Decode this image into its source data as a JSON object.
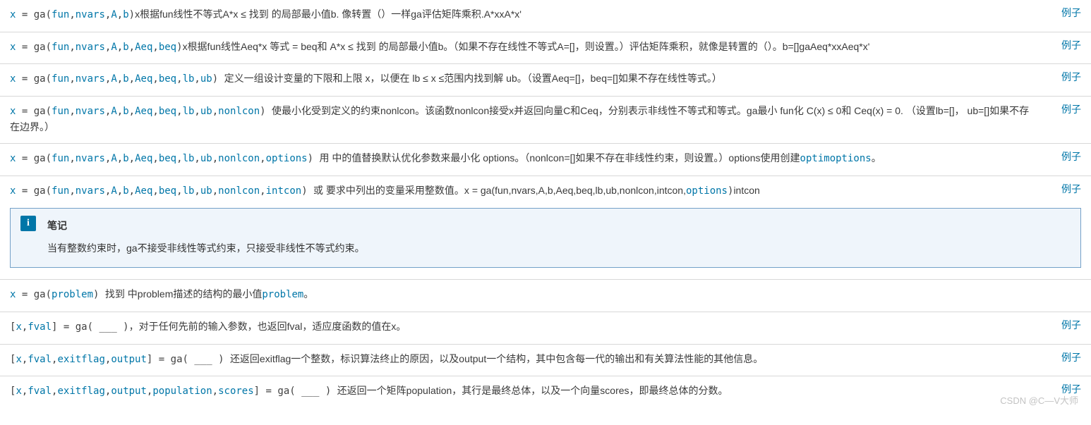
{
  "labels": {
    "example": "例子",
    "note_title": "笔记",
    "note_body": "当有整数约束时，ga不接受非线性等式约束，只接受非线性不等式约束。",
    "watermark": "CSDN @C—V大师"
  },
  "rows": [
    {
      "has_example": true,
      "parts": [
        {
          "t": "k",
          "v": "x"
        },
        {
          "t": "code",
          "v": " = ga("
        },
        {
          "t": "k",
          "v": "fun"
        },
        {
          "t": "code",
          "v": ","
        },
        {
          "t": "k",
          "v": "nvars"
        },
        {
          "t": "code",
          "v": ","
        },
        {
          "t": "k",
          "v": "A"
        },
        {
          "t": "code",
          "v": ","
        },
        {
          "t": "k",
          "v": "b"
        },
        {
          "t": "code",
          "v": ")"
        },
        {
          "t": "txt",
          "v": "x根据fun线性不等式A*x ≤ 找到 的局部最小值b. 像转置（）一样ga评估矩阵乘积.A*xxA*x'"
        }
      ]
    },
    {
      "has_example": true,
      "parts": [
        {
          "t": "k",
          "v": "x"
        },
        {
          "t": "code",
          "v": " = ga("
        },
        {
          "t": "k",
          "v": "fun"
        },
        {
          "t": "code",
          "v": ","
        },
        {
          "t": "k",
          "v": "nvars"
        },
        {
          "t": "code",
          "v": ","
        },
        {
          "t": "k",
          "v": "A"
        },
        {
          "t": "code",
          "v": ","
        },
        {
          "t": "k",
          "v": "b"
        },
        {
          "t": "code",
          "v": ","
        },
        {
          "t": "k",
          "v": "Aeq"
        },
        {
          "t": "code",
          "v": ","
        },
        {
          "t": "k",
          "v": "beq"
        },
        {
          "t": "code",
          "v": ")"
        },
        {
          "t": "txt",
          "v": "x根据fun线性Aeq*x 等式 = beq和 A*x ≤ 找到 的局部最小值b。（如果不存在线性不等式A=[]，则设置。）评估矩阵乘积，就像是转置的（）。b=[]gaAeq*xxAeq*x'"
        }
      ]
    },
    {
      "has_example": true,
      "parts": [
        {
          "t": "k",
          "v": "x"
        },
        {
          "t": "code",
          "v": " = ga("
        },
        {
          "t": "k",
          "v": "fun"
        },
        {
          "t": "code",
          "v": ","
        },
        {
          "t": "k",
          "v": "nvars"
        },
        {
          "t": "code",
          "v": ","
        },
        {
          "t": "k",
          "v": "A"
        },
        {
          "t": "code",
          "v": ","
        },
        {
          "t": "k",
          "v": "b"
        },
        {
          "t": "code",
          "v": ","
        },
        {
          "t": "k",
          "v": "Aeq"
        },
        {
          "t": "code",
          "v": ","
        },
        {
          "t": "k",
          "v": "beq"
        },
        {
          "t": "code",
          "v": ","
        },
        {
          "t": "k",
          "v": "lb"
        },
        {
          "t": "code",
          "v": ","
        },
        {
          "t": "k",
          "v": "ub"
        },
        {
          "t": "code",
          "v": ") "
        },
        {
          "t": "txt",
          "v": "定义一组设计变量的下限和上限 x，以便在 lb ≤  x ≤范围内找到解 ub。（设置Aeq=[]，beq=[]如果不存在线性等式。）"
        }
      ]
    },
    {
      "has_example": true,
      "parts": [
        {
          "t": "k",
          "v": "x"
        },
        {
          "t": "code",
          "v": " = ga("
        },
        {
          "t": "k",
          "v": "fun"
        },
        {
          "t": "code",
          "v": ","
        },
        {
          "t": "k",
          "v": "nvars"
        },
        {
          "t": "code",
          "v": ","
        },
        {
          "t": "k",
          "v": "A"
        },
        {
          "t": "code",
          "v": ","
        },
        {
          "t": "k",
          "v": "b"
        },
        {
          "t": "code",
          "v": ","
        },
        {
          "t": "k",
          "v": "Aeq"
        },
        {
          "t": "code",
          "v": ","
        },
        {
          "t": "k",
          "v": "beq"
        },
        {
          "t": "code",
          "v": ","
        },
        {
          "t": "k",
          "v": "lb"
        },
        {
          "t": "code",
          "v": ","
        },
        {
          "t": "k",
          "v": "ub"
        },
        {
          "t": "code",
          "v": ","
        },
        {
          "t": "k",
          "v": "nonlcon"
        },
        {
          "t": "code",
          "v": ") "
        },
        {
          "t": "txt",
          "v": "使最小化受到定义的约束nonlcon。该函数nonlcon接受x并返回向量C和Ceq，分别表示非线性不等式和等式。ga最小 fun化 C(x) ≤ 0和 Ceq(x) = 0. （设置lb=[]， ub=[]如果不存在边界。）"
        }
      ]
    },
    {
      "has_example": true,
      "parts": [
        {
          "t": "k",
          "v": "x"
        },
        {
          "t": "code",
          "v": " = ga("
        },
        {
          "t": "k",
          "v": "fun"
        },
        {
          "t": "code",
          "v": ","
        },
        {
          "t": "k",
          "v": "nvars"
        },
        {
          "t": "code",
          "v": ","
        },
        {
          "t": "k",
          "v": "A"
        },
        {
          "t": "code",
          "v": ","
        },
        {
          "t": "k",
          "v": "b"
        },
        {
          "t": "code",
          "v": ","
        },
        {
          "t": "k",
          "v": "Aeq"
        },
        {
          "t": "code",
          "v": ","
        },
        {
          "t": "k",
          "v": "beq"
        },
        {
          "t": "code",
          "v": ","
        },
        {
          "t": "k",
          "v": "lb"
        },
        {
          "t": "code",
          "v": ","
        },
        {
          "t": "k",
          "v": "ub"
        },
        {
          "t": "code",
          "v": ","
        },
        {
          "t": "k",
          "v": "nonlcon"
        },
        {
          "t": "code",
          "v": ","
        },
        {
          "t": "k",
          "v": "options"
        },
        {
          "t": "code",
          "v": ") "
        },
        {
          "t": "txt",
          "v": "用 中的值替换默认优化参数来最小化 options。（nonlcon=[]如果不存在非线性约束，则设置。）options使用创建"
        },
        {
          "t": "link",
          "v": "optimoptions"
        },
        {
          "t": "txt",
          "v": "。"
        }
      ]
    },
    {
      "has_example": true,
      "note": true,
      "parts": [
        {
          "t": "k",
          "v": "x"
        },
        {
          "t": "code",
          "v": " = ga("
        },
        {
          "t": "k",
          "v": "fun"
        },
        {
          "t": "code",
          "v": ","
        },
        {
          "t": "k",
          "v": "nvars"
        },
        {
          "t": "code",
          "v": ","
        },
        {
          "t": "k",
          "v": "A"
        },
        {
          "t": "code",
          "v": ","
        },
        {
          "t": "k",
          "v": "b"
        },
        {
          "t": "code",
          "v": ","
        },
        {
          "t": "k",
          "v": "Aeq"
        },
        {
          "t": "code",
          "v": ","
        },
        {
          "t": "k",
          "v": "beq"
        },
        {
          "t": "code",
          "v": ","
        },
        {
          "t": "k",
          "v": "lb"
        },
        {
          "t": "code",
          "v": ","
        },
        {
          "t": "k",
          "v": "ub"
        },
        {
          "t": "code",
          "v": ","
        },
        {
          "t": "k",
          "v": "nonlcon"
        },
        {
          "t": "code",
          "v": ","
        },
        {
          "t": "k",
          "v": "intcon"
        },
        {
          "t": "code",
          "v": ") "
        },
        {
          "t": "txt",
          "v": "或 要求中列出的变量采用整数值。x = ga(fun,nvars,A,b,Aeq,beq,lb,ub,nonlcon,intcon,"
        },
        {
          "t": "k",
          "v": "options"
        },
        {
          "t": "code",
          "v": ")"
        },
        {
          "t": "txt",
          "v": "intcon"
        }
      ]
    },
    {
      "has_example": false,
      "parts": [
        {
          "t": "k",
          "v": "x"
        },
        {
          "t": "code",
          "v": " = ga("
        },
        {
          "t": "k",
          "v": "problem"
        },
        {
          "t": "code",
          "v": ") "
        },
        {
          "t": "txt",
          "v": "找到 中problem描述的结构的最小值"
        },
        {
          "t": "link",
          "v": "problem"
        },
        {
          "t": "txt",
          "v": "。"
        }
      ]
    },
    {
      "has_example": true,
      "parts": [
        {
          "t": "code",
          "v": "["
        },
        {
          "t": "k",
          "v": "x"
        },
        {
          "t": "code",
          "v": ","
        },
        {
          "t": "k",
          "v": "fval"
        },
        {
          "t": "code",
          "v": "] = ga( ___ )"
        },
        {
          "t": "txt",
          "v": "，对于任何先前的输入参数，也返回fval，适应度函数的值在x。"
        }
      ]
    },
    {
      "has_example": true,
      "parts": [
        {
          "t": "code",
          "v": "["
        },
        {
          "t": "k",
          "v": "x"
        },
        {
          "t": "code",
          "v": ","
        },
        {
          "t": "k",
          "v": "fval"
        },
        {
          "t": "code",
          "v": ","
        },
        {
          "t": "k",
          "v": "exitflag"
        },
        {
          "t": "code",
          "v": ","
        },
        {
          "t": "k",
          "v": "output"
        },
        {
          "t": "code",
          "v": "] = ga( ___ ) "
        },
        {
          "t": "txt",
          "v": "还返回exitflag一个整数，标识算法终止的原因，以及output一个结构，其中包含每一代的输出和有关算法性能的其他信息。"
        }
      ]
    },
    {
      "has_example": true,
      "parts": [
        {
          "t": "code",
          "v": "["
        },
        {
          "t": "k",
          "v": "x"
        },
        {
          "t": "code",
          "v": ","
        },
        {
          "t": "k",
          "v": "fval"
        },
        {
          "t": "code",
          "v": ","
        },
        {
          "t": "k",
          "v": "exitflag"
        },
        {
          "t": "code",
          "v": ","
        },
        {
          "t": "k",
          "v": "output"
        },
        {
          "t": "code",
          "v": ","
        },
        {
          "t": "k",
          "v": "population"
        },
        {
          "t": "code",
          "v": ","
        },
        {
          "t": "k",
          "v": "scores"
        },
        {
          "t": "code",
          "v": "] = ga( ___ ) "
        },
        {
          "t": "txt",
          "v": "还返回一个矩阵population，其行是最终总体，以及一个向量scores，即最终总体的分数。"
        }
      ]
    }
  ]
}
